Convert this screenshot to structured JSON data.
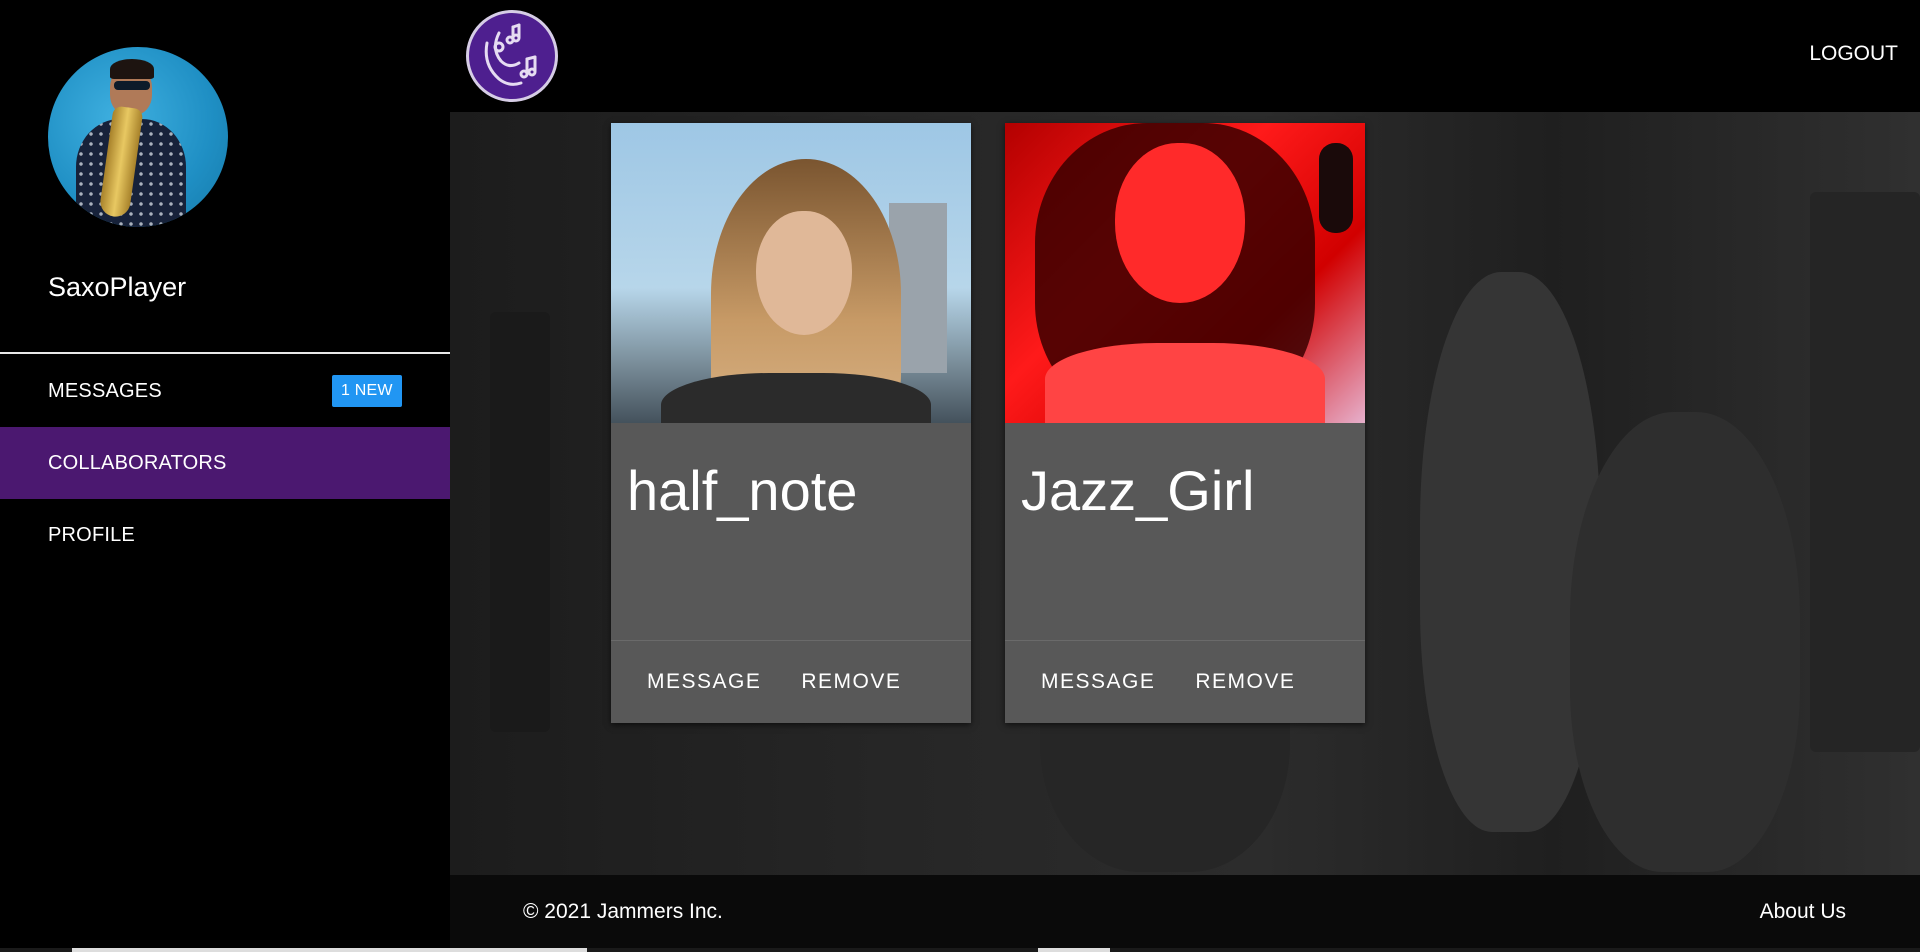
{
  "sidebar": {
    "username": "SaxoPlayer",
    "nav": [
      {
        "label": "MESSAGES",
        "badge": "1 NEW",
        "active": false
      },
      {
        "label": "COLLABORATORS",
        "active": true
      },
      {
        "label": "PROFILE",
        "active": false
      }
    ]
  },
  "header": {
    "logout_label": "LOGOUT"
  },
  "collaborators": [
    {
      "name": "half_note",
      "message_label": "MESSAGE",
      "remove_label": "REMOVE"
    },
    {
      "name": "Jazz_Girl",
      "message_label": "MESSAGE",
      "remove_label": "REMOVE"
    }
  ],
  "footer": {
    "copyright": "© 2021 Jammers Inc.",
    "about_label": "About Us"
  },
  "colors": {
    "active_nav": "#4b1870",
    "badge": "#2196f3",
    "logo_bg": "#4e1f8f",
    "card_bg": "#585858"
  }
}
